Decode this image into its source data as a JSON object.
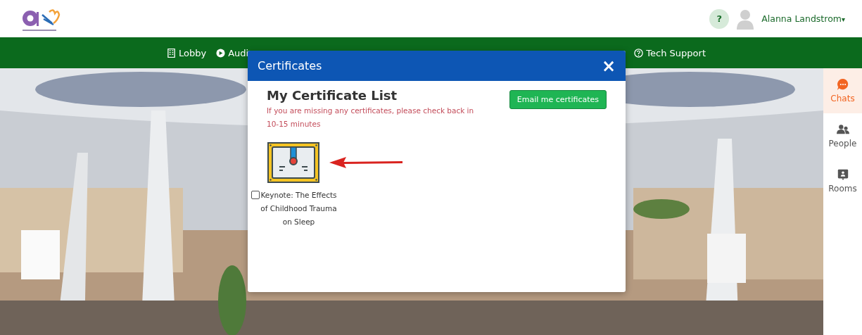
{
  "header": {
    "help_button": "?",
    "user_name": "Alanna Landstrom",
    "menu_caret": "▾"
  },
  "nav": {
    "items": [
      {
        "label": "Lobby"
      },
      {
        "label": "Audi"
      }
    ],
    "end_items": [
      {
        "label": "Tech Support"
      }
    ]
  },
  "modal": {
    "title": "Certificates",
    "close": "×",
    "heading": "My Certificate List",
    "notice": "If you are missing any certificates, please check back in 10-15 minutes",
    "email_button": "Email me certificates",
    "certificates": [
      {
        "title": "Keynote: The Effects of Childhood Trauma on Sleep",
        "checked": false
      }
    ]
  },
  "side_panel": {
    "items": [
      {
        "label": "Chats",
        "selected": true
      },
      {
        "label": "People",
        "selected": false
      },
      {
        "label": "Rooms",
        "selected": false
      }
    ]
  }
}
